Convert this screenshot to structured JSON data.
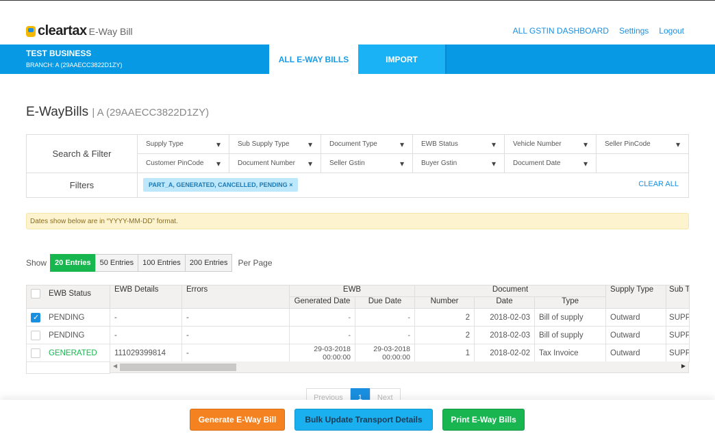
{
  "header": {
    "brand": "cleartax",
    "product": "E-Way Bill",
    "links": [
      "ALL GSTIN DASHBOARD",
      "Settings",
      "Logout"
    ]
  },
  "business": {
    "name": "TEST BUSINESS",
    "branch": "BRANCH: A (29AAECC3822D1ZY)"
  },
  "tabs": [
    "ALL E-WAY BILLS",
    "IMPORT"
  ],
  "page": {
    "title": "E-WayBills",
    "subtitle": "| A (29AAECC3822D1ZY)"
  },
  "filter": {
    "search_label": "Search & Filter",
    "filters_label": "Filters",
    "row1": [
      "Supply Type",
      "Sub Supply Type",
      "Document Type",
      "EWB Status",
      "Vehicle Number",
      "Seller PinCode"
    ],
    "row2": [
      "Customer PinCode",
      "Document Number",
      "Seller Gstin",
      "Buyer Gstin",
      "Document Date"
    ],
    "chip": "PART_A, GENERATED, CANCELLED, PENDING",
    "chip_close": "×",
    "clear_all": "CLEAR ALL"
  },
  "notice": "Dates show below are in “YYYY-MM-DD” format.",
  "entries": {
    "show": "Show",
    "options": [
      "20 Entries",
      "50 Entries",
      "100 Entries",
      "200 Entries"
    ],
    "selected": "20 Entries",
    "per_page": "Per Page"
  },
  "table": {
    "headers": {
      "status": "EWB Status",
      "details": "EWB Details",
      "errors": "Errors",
      "ewb": "EWB",
      "generated": "Generated Date",
      "due": "Due Date",
      "document": "Document",
      "number": "Number",
      "date": "Date",
      "type": "Type",
      "supply": "Supply Type",
      "sub": "Sub T"
    },
    "rows": [
      {
        "checked": true,
        "status": "PENDING",
        "details": "-",
        "errors": "-",
        "generated": "-",
        "due": "-",
        "number": "2",
        "date": "2018-02-03",
        "type": "Bill of supply",
        "supply": "Outward",
        "sub": "SUPP"
      },
      {
        "checked": false,
        "status": "PENDING",
        "details": "-",
        "errors": "-",
        "generated": "-",
        "due": "-",
        "number": "2",
        "date": "2018-02-03",
        "type": "Bill of supply",
        "supply": "Outward",
        "sub": "SUPP"
      },
      {
        "checked": false,
        "status": "GENERATED",
        "details": "111029399814",
        "errors": "-",
        "generated": "29-03-2018\n00:00:00",
        "due": "29-03-2018\n00:00:00",
        "number": "1",
        "date": "2018-02-02",
        "type": "Tax Invoice",
        "supply": "Outward",
        "sub": "SUPP"
      }
    ]
  },
  "pagination": {
    "previous": "Previous",
    "current": "1",
    "next": "Next"
  },
  "actions": {
    "generate": "Generate E-Way Bill",
    "bulk": "Bulk Update Transport Details",
    "print": "Print E-Way Bills"
  }
}
